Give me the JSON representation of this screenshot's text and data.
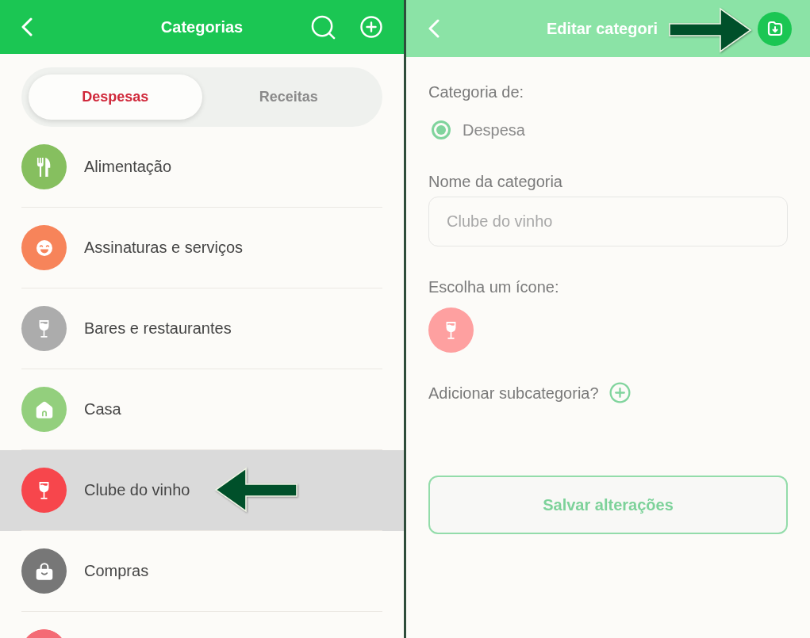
{
  "left_screen": {
    "header": {
      "title": "Categorias"
    },
    "tabs": [
      {
        "label": "Despesas",
        "selected": true
      },
      {
        "label": "Receitas",
        "selected": false
      }
    ],
    "categories": [
      {
        "name": "Alimentação",
        "color": "#86bf5f",
        "selected": false,
        "arrow": false
      },
      {
        "name": "Assinaturas e serviços",
        "color": "#f7845a",
        "selected": false,
        "arrow": false
      },
      {
        "name": "Bares e restaurantes",
        "color": "#acacac",
        "selected": false,
        "arrow": false
      },
      {
        "name": "Casa",
        "color": "#93cf7d",
        "selected": false,
        "arrow": false
      },
      {
        "name": "Clube do vinho",
        "color": "#f7464c",
        "selected": true,
        "arrow": true
      },
      {
        "name": "Compras",
        "color": "#777777",
        "selected": false,
        "arrow": false
      },
      {
        "color": "#f46b75",
        "selected": false
      }
    ]
  },
  "right_screen": {
    "header": {
      "title": "Editar categori",
      "save_arrow": true
    },
    "type_label": "Categoria de:",
    "type_option": {
      "label": "Despesa",
      "selected": true
    },
    "name_label": "Nome da categoria",
    "name_field": {
      "value": "Clube do vinho"
    },
    "icon_label": "Escolha um ícone:",
    "add_subcategory_label": "Adicionar subcategoria?",
    "save_button": "Salvar alterações"
  }
}
